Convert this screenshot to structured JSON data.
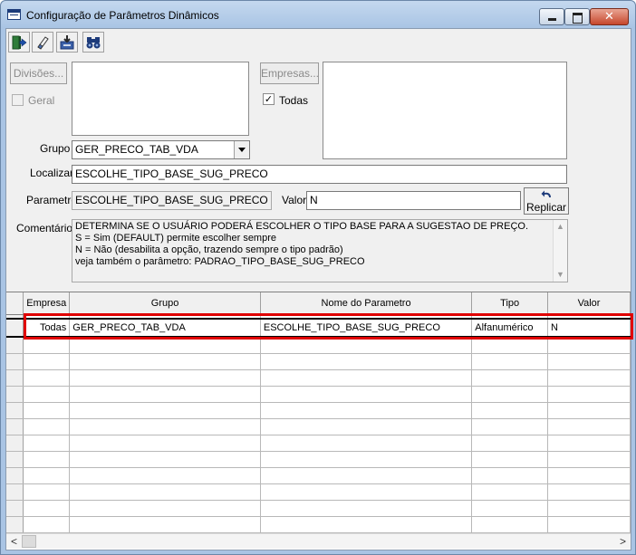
{
  "window": {
    "title": "Configuração de Parâmetros Dinâmicos",
    "close_glyph": "✕"
  },
  "toolbar": {
    "buttons": [
      {
        "name": "exit-icon"
      },
      {
        "name": "eraser-icon"
      },
      {
        "name": "save-icon"
      },
      {
        "name": "binoculars-icon"
      }
    ]
  },
  "filters": {
    "divisoes_label": "Divisões...",
    "geral_label": "Geral",
    "geral_checked": false,
    "empresas_label": "Empresas...",
    "todas_label": "Todas",
    "todas_checked": true,
    "todas_check_glyph": "✓"
  },
  "form": {
    "grupo_label": "Grupo",
    "grupo_value": "GER_PRECO_TAB_VDA",
    "localizar_label": "Localizar",
    "localizar_value": "ESCOLHE_TIPO_BASE_SUG_PRECO",
    "parametro_label": "Parametro",
    "parametro_value": "ESCOLHE_TIPO_BASE_SUG_PRECO",
    "valor_label": "Valor",
    "valor_value": "N",
    "replicar_label": "Replicar",
    "comentarios_label": "Comentários",
    "comentarios_lines": [
      "DETERMINA SE O USUÁRIO PODERÁ ESCOLHER O TIPO BASE PARA A SUGESTAO DE PREÇO.",
      "S = Sim (DEFAULT) permite escolher sempre",
      "N = Não (desabilita a opção, trazendo sempre o tipo padrão)",
      "veja também o parâmetro: PADRAO_TIPO_BASE_SUG_PRECO"
    ]
  },
  "grid": {
    "columns": [
      "Empresa",
      "Grupo",
      "Nome do Parametro",
      "Tipo",
      "Valor"
    ],
    "rows": [
      {
        "empresa": "Todas",
        "grupo": "GER_PRECO_TAB_VDA",
        "nome": "ESCOLHE_TIPO_BASE_SUG_PRECO",
        "tipo": "Alfanumérico",
        "valor": "N",
        "selected": true
      }
    ],
    "empty_row_count": 12,
    "hscroll_left_glyph": "<",
    "hscroll_right_glyph": ">"
  }
}
